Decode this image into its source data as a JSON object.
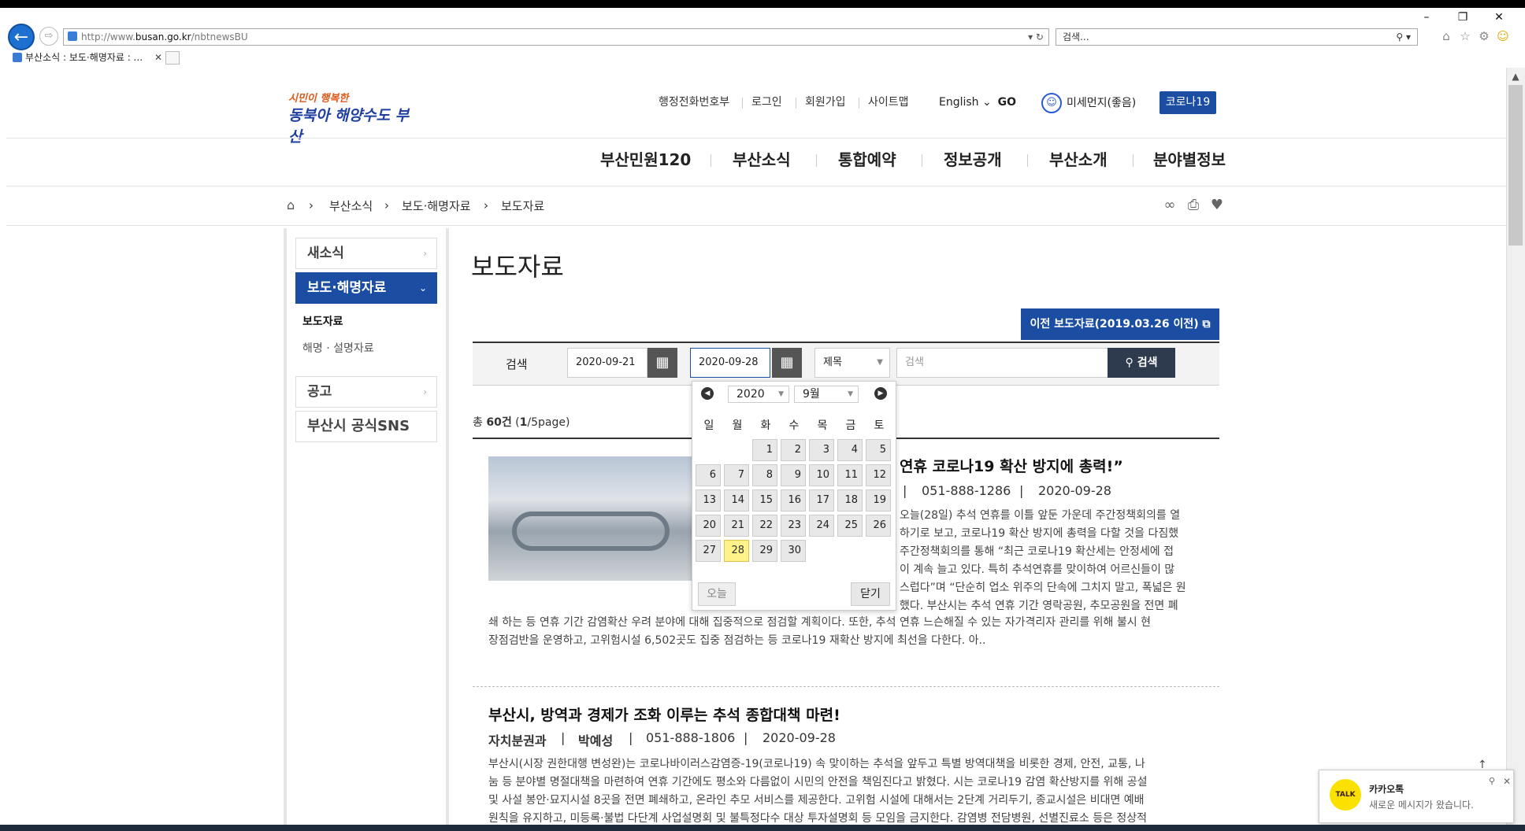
{
  "browser": {
    "url_prefix": "http://www.",
    "url_domain": "busan.go.kr",
    "url_path": "/nbtnewsBU",
    "search_placeholder": "검색...",
    "tab_title": "부산소식 : 보도·해명자료 : ...",
    "icons": [
      "back-icon",
      "forward-icon",
      "refresh-icon",
      "search-icon",
      "home-icon",
      "star-icon",
      "gear-icon",
      "smiley-icon"
    ]
  },
  "header": {
    "logo_line1": "시민이 행복한",
    "logo_line2": "동북아 해양수도 부산",
    "util_links": [
      "행정전화번호부",
      "로그인",
      "회원가입",
      "사이트맵"
    ],
    "lang_label": "English",
    "lang_go": "GO",
    "dust_label": "미세먼지(좋음)",
    "corona_label": "코로나19"
  },
  "gnb": [
    "부산민원120",
    "부산소식",
    "통합예약",
    "정보공개",
    "부산소개",
    "분야별정보"
  ],
  "breadcrumb": [
    "부산소식",
    "보도·해명자료",
    "보도자료"
  ],
  "lnb": {
    "items": [
      "새소식",
      "보도·해명자료",
      "공고",
      "부산시 공식SNS"
    ],
    "subitems": [
      "보도자료",
      "해명 · 설명자료"
    ]
  },
  "content": {
    "page_title": "보도자료",
    "prev_button": "이전 보도자료(2019.03.26 이전)",
    "search_label": "검색",
    "date_from": "2020-09-21",
    "date_to": "2020-09-28",
    "select_value": "제목",
    "keyword_placeholder": "검색",
    "search_button": "검색",
    "total_prefix": "총",
    "total_count": "60건",
    "page_info_open": "(",
    "page_current": "1",
    "page_info_rest": "/5page)"
  },
  "articles": [
    {
      "title_visible": "연휴 코로나19 확산 방지에 총력!”",
      "meta_sep": "|",
      "phone": "051-888-1286",
      "date": "2020-09-28",
      "body_right": [
        "오늘(28일) 추석 연휴를 이틀 앞둔 가운데 주간정책회의를 열",
        "하기로 보고, 코로나19 확산 방지에 총력을 다할 것을 다짐했",
        "주간정책회의를 통해 “최근 코로나19 확산세는 안정세에 접",
        "이 계속 늘고 있다. 특히 추석연휴를 맞이하여 어르신들이 많",
        "스럽다”며 “단순히 업소 위주의 단속에 그치지 말고, 폭넓은 원",
        "했다. 부산시는 추석 연휴 기간 영락공원, 추모공원을 전면 폐"
      ],
      "body_full": [
        "쇄 하는 등 연휴 기간 감염확산 우려 분야에 대해 집중적으로 점검할 계획이다. 또한, 추석 연휴 느슨해질 수 있는 자가격리자 관리를 위해 불시 현",
        "장점검반을 운영하고, 고위험시설 6,502곳도 집중 점검하는 등 코로나19 재확산 방지에 최선을 다한다. 아.."
      ]
    },
    {
      "title": "부산시, 방역과 경제가 조화 이루는 추석 종합대책 마련!",
      "dept": "자치분권과",
      "person": "박예성",
      "meta_sep": "|",
      "phone": "051-888-1806",
      "date": "2020-09-28",
      "body": [
        "부산시(시장 권한대행 변성완)는 코로나바이러스감염증-19(코로나19) 속 맞이하는 추석을 앞두고 특별 방역대책을 비롯한 경제, 안전, 교통, 나",
        "눔 등 분야별 명절대책을 마련하여 연휴 기간에도 평소와 다름없이 시민의 안전을 책임진다고 밝혔다. 시는 코로나19 감염 확산방지를 위해 공설",
        "및 사설 봉안·묘지시설 8곳을 전면 폐쇄하고, 온라인 추모 서비스를 제공한다. 고위험 시설에 대해서는 2단계 거리두기, 종교시설은 비대면 예배",
        "원칙을 유지하고, 미등록·불법 다단계 사업설명회 및 불특정다수 대상 투자설명회 등 모임을 금지한다. 감염병 전담병원, 선별진료소 등은 정상적"
      ]
    }
  ],
  "calendar": {
    "year": "2020",
    "month": "9월",
    "weekdays": [
      "일",
      "월",
      "화",
      "수",
      "목",
      "금",
      "토"
    ],
    "days": [
      "1",
      "2",
      "3",
      "4",
      "5",
      "6",
      "7",
      "8",
      "9",
      "10",
      "11",
      "12",
      "13",
      "14",
      "15",
      "16",
      "17",
      "18",
      "19",
      "20",
      "21",
      "22",
      "23",
      "24",
      "25",
      "26",
      "27",
      "28",
      "29",
      "30"
    ],
    "today_label": "오늘",
    "close_label": "닫기",
    "selected_day": "28"
  },
  "kakao": {
    "app_name": "카카오톡",
    "icon_text": "TALK",
    "message": "새로운 메시지가 왔습니다."
  },
  "colors": {
    "brand_blue": "#1b4ea3",
    "today_yellow": "#fff28a",
    "kakao_yellow": "#fae100"
  }
}
